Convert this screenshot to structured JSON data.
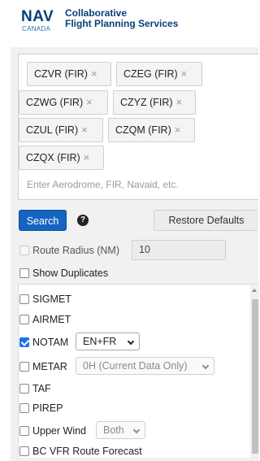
{
  "header": {
    "logo_nav": "NAV",
    "logo_canada": "CANADA",
    "brand_line1": "Collaborative",
    "brand_line2": "Flight Planning Services"
  },
  "search": {
    "tags": [
      "CZVR (FIR)",
      "CZEG (FIR)",
      "CZWG (FIR)",
      "CZYZ (FIR)",
      "CZUL (FIR)",
      "CZQM (FIR)",
      "CZQX (FIR)"
    ],
    "remove_glyph": "×",
    "placeholder": "Enter Aerodrome, FIR, Navaid, etc.",
    "search_label": "Search",
    "help_glyph": "?",
    "restore_label": "Restore Defaults"
  },
  "options": {
    "route_radius_label": "Route Radius (NM)",
    "route_radius_value": "10",
    "route_radius_checked": false,
    "show_duplicates_label": "Show Duplicates",
    "show_duplicates_checked": false
  },
  "products": {
    "sigmet": {
      "label": "SIGMET",
      "checked": false
    },
    "airmet": {
      "label": "AIRMET",
      "checked": false
    },
    "notam": {
      "label": "NOTAM",
      "checked": true,
      "select_value": "EN+FR"
    },
    "metar": {
      "label": "METAR",
      "checked": false,
      "select_value": "0H (Current Data Only)"
    },
    "taf": {
      "label": "TAF",
      "checked": false
    },
    "pirep": {
      "label": "PIREP",
      "checked": false
    },
    "upper_wind": {
      "label": "Upper Wind",
      "checked": false,
      "select_value": "Both"
    },
    "bc_vfr": {
      "label": "BC VFR Route Forecast",
      "checked": false
    }
  },
  "colors": {
    "accent": "#1565c0",
    "brand": "#0a3e7a"
  }
}
